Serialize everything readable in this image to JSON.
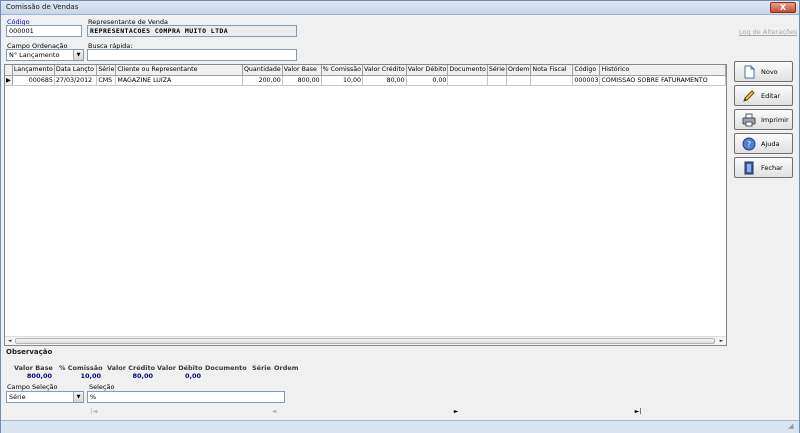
{
  "window": {
    "title": "Comissão de Vendas",
    "close_label": "X"
  },
  "form": {
    "codigo_label": "Código",
    "codigo_value": "000001",
    "representante_label": "Representante de Venda",
    "representante_value": "REPRESENTACOES COMPRA MUITO LTDA",
    "campo_ordenacao_label": "Campo Ordenação",
    "campo_ordenacao_value": "N° Lançamento",
    "busca_label": "Busca rápida:",
    "busca_value": ""
  },
  "log_label": "Log de Alterações",
  "grid": {
    "columns": [
      "Lançamento",
      "Data Lançto",
      "Série",
      "Cliente ou Representante",
      "Quantidade",
      "Valor Base",
      "% Comissão",
      "Valor Crédito",
      "Valor Débito",
      "Documento",
      "Série",
      "Ordem",
      "Nota Fiscal",
      "Código",
      "Histórico"
    ],
    "rows": [
      [
        "000685",
        "27/03/2012",
        "CMS",
        "MAGAZINE LUIZA",
        "200,00",
        "800,00",
        "10,00",
        "80,00",
        "0,00",
        "",
        "",
        "",
        "",
        "000003",
        "COMISSAO SOBRE FATURAMENTO"
      ]
    ]
  },
  "observacao": {
    "title": "Observação",
    "valor_base_label": "Valor Base",
    "valor_base_value": "800,00",
    "comissao_label": "% Comissão",
    "comissao_value": "10,00",
    "credito_label": "Valor Crédito",
    "credito_value": "80,00",
    "debito_label": "Valor Débito",
    "debito_value": "0,00",
    "documento_label": "Documento",
    "serie_label": "Série",
    "ordem_label": "Ordem"
  },
  "filter": {
    "campo_selecao_label": "Campo Seleção",
    "campo_selecao_value": "Série",
    "selecao_label": "Seleção",
    "selecao_value": "%"
  },
  "buttons": {
    "novo": "Novo",
    "editar": "Editar",
    "imprimir": "Imprimir",
    "ajuda": "Ajuda",
    "fechar": "Fechar"
  },
  "nav": {
    "first": "|◄",
    "prev": "◄",
    "next": "►",
    "last": "►|"
  }
}
